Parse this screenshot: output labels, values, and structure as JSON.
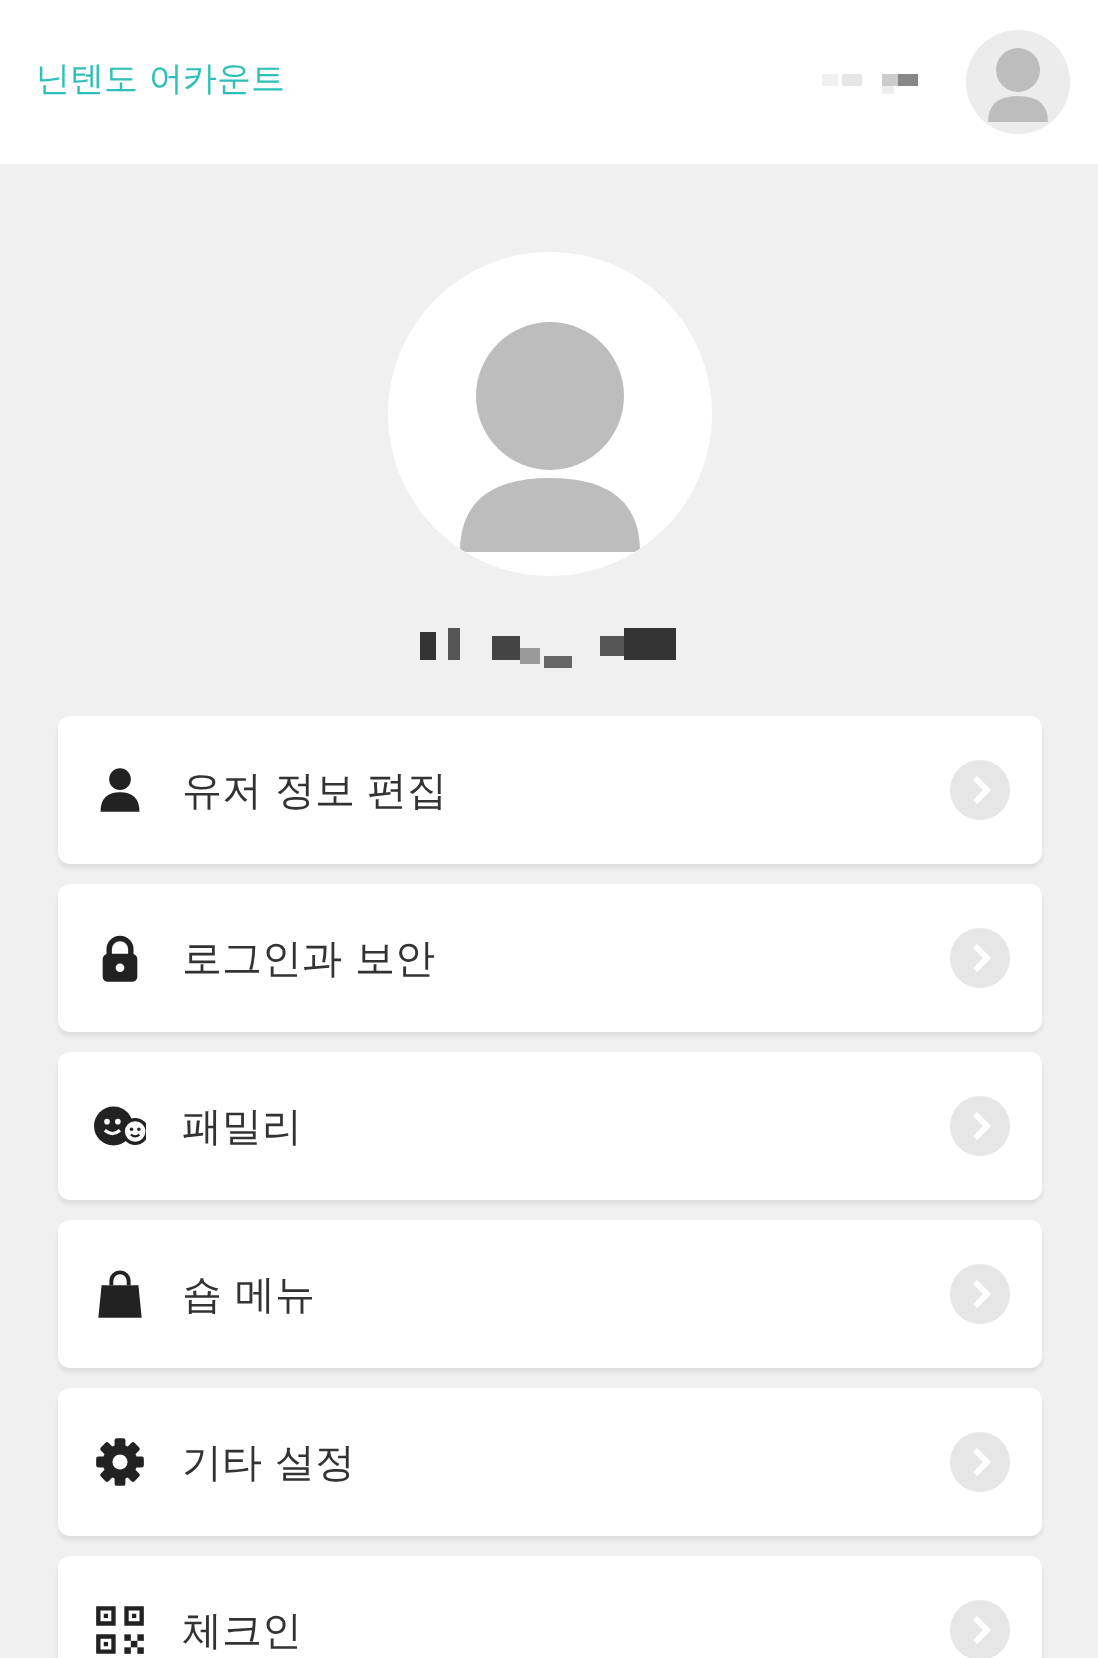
{
  "header": {
    "title": "닌텐도 어카운트"
  },
  "menu": [
    {
      "kind": "person",
      "label": "유저 정보 편집"
    },
    {
      "kind": "lock",
      "label": "로그인과 보안"
    },
    {
      "kind": "family",
      "label": "패밀리"
    },
    {
      "kind": "bag",
      "label": "숍 메뉴"
    },
    {
      "kind": "gear",
      "label": "기타 설정"
    },
    {
      "kind": "qr",
      "label": "체크인"
    }
  ]
}
